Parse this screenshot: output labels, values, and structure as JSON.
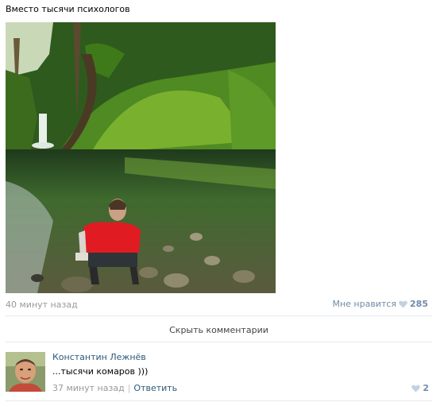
{
  "post": {
    "text": "Вместо тысячи психологов",
    "time": "40 минут назад",
    "like_label": "Мне нравится",
    "like_count": "285"
  },
  "comments_toggle": "Скрыть комментарии",
  "comment": {
    "author": "Константин Лежнёв",
    "text": "...тысячи комаров )))",
    "time": "37 минут назад",
    "separator": "|",
    "reply_label": "Ответить",
    "like_count": "2"
  },
  "colors": {
    "link": "#2b587a",
    "like": "#6f8ca9",
    "muted": "#999999",
    "heart": "#c3d2e0"
  }
}
